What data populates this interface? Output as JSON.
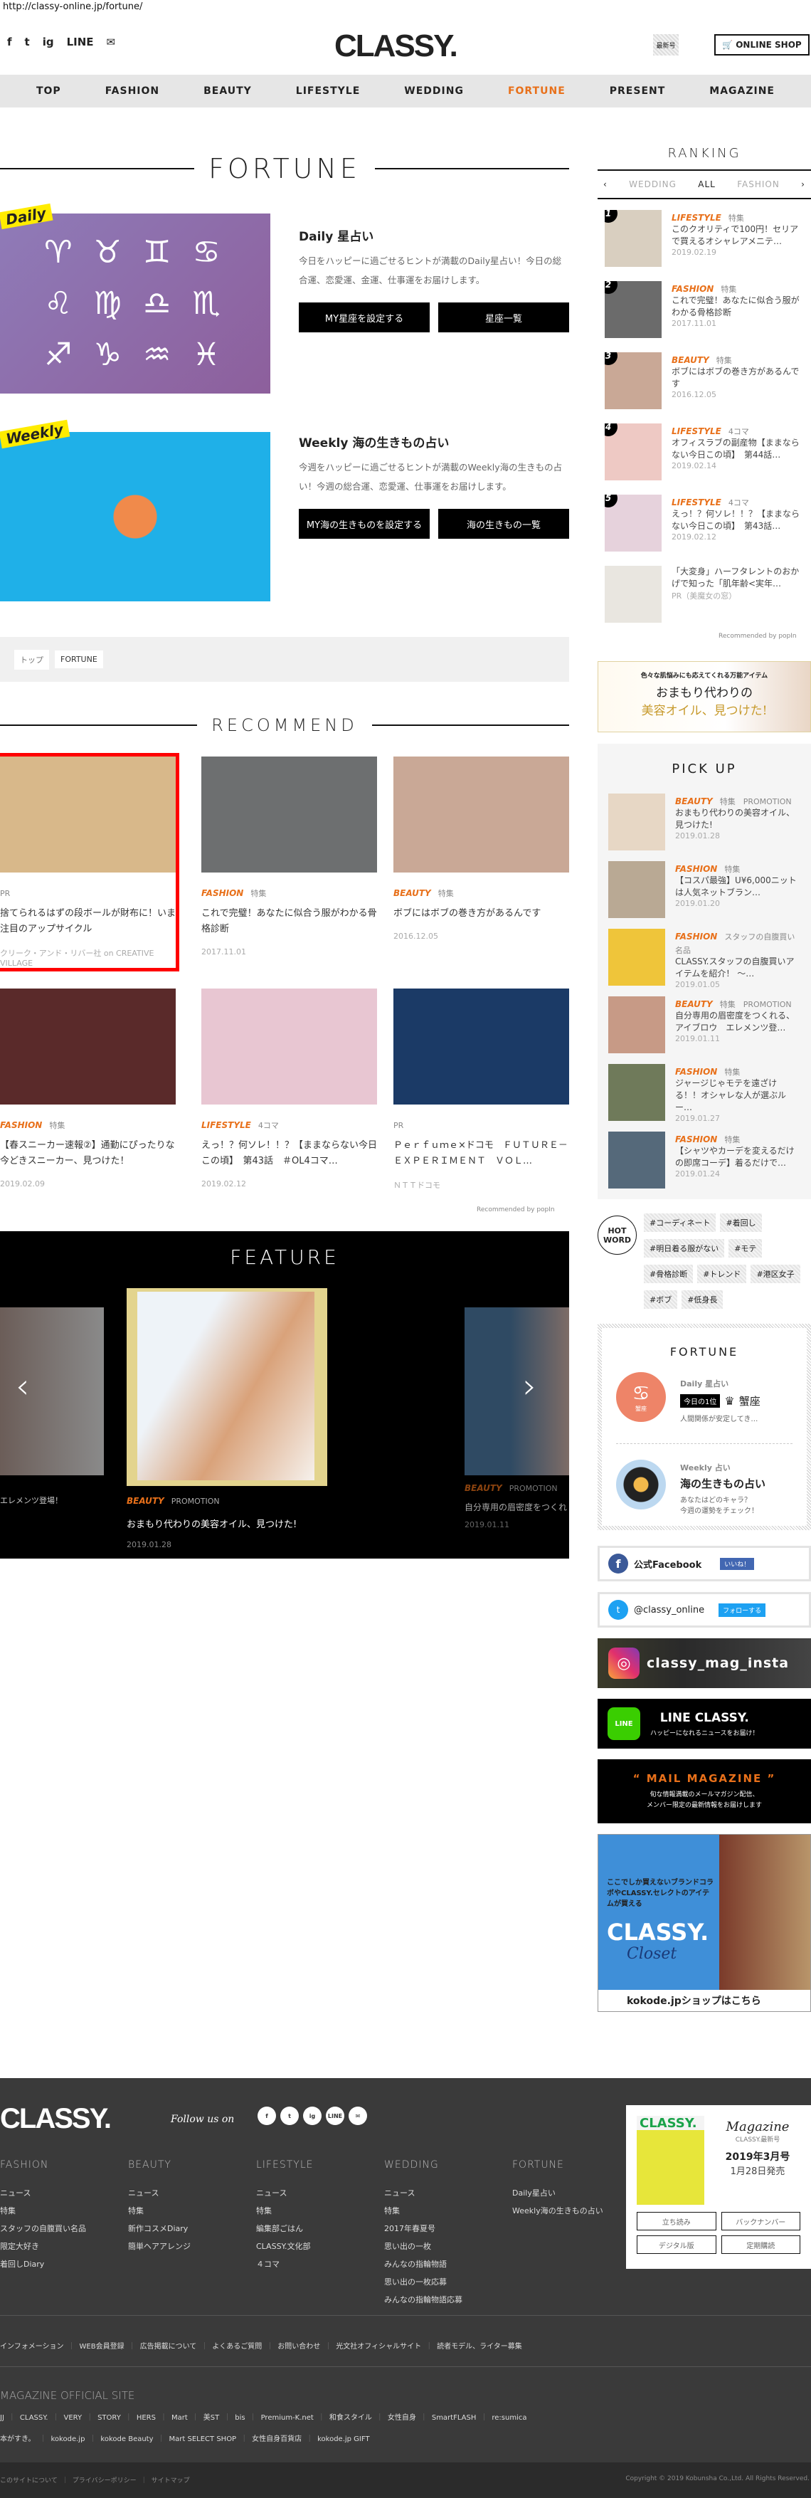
{
  "url": "http://classy-online.jp/fortune/",
  "header": {
    "logo": "CLASSY.",
    "social": [
      "f",
      "t",
      "ig",
      "LINE",
      "✉"
    ],
    "latest_label": "最新号",
    "shop_label": "ONLINE SHOP"
  },
  "nav": [
    {
      "label": "TOP"
    },
    {
      "label": "FASHION"
    },
    {
      "label": "BEAUTY"
    },
    {
      "label": "LIFESTYLE"
    },
    {
      "label": "WEDDING"
    },
    {
      "label": "FORTUNE",
      "active": true
    },
    {
      "label": "PRESENT"
    },
    {
      "label": "MAGAZINE"
    }
  ],
  "fortune": {
    "title": "FORTUNE",
    "daily": {
      "badge": "Daily",
      "heading": "Daily 星占い",
      "desc": "今日をハッピーに過ごせるヒントが満載のDaily星占い！今日の総合運、恋愛運、金運、仕事運をお届けします。",
      "btn1": "MY星座を設定する",
      "btn2": "星座一覧",
      "zodiac": "♈ ♉ ♊ ♋ ♌ ♍ ♎ ♏ ♐ ♑ ♒ ♓"
    },
    "weekly": {
      "badge": "Weekly",
      "heading": "Weekly 海の生きもの占い",
      "desc": "今週をハッピーに過ごせるヒントが満載のWeekly海の生きもの占い！今週の総合運、恋愛運、仕事運をお届けします。",
      "btn1": "MY海の生きものを設定する",
      "btn2": "海の生きもの一覧"
    }
  },
  "breadcrumb": [
    "トップ",
    "FORTUNE"
  ],
  "recommend": {
    "title": "RECOMMEND",
    "popin": "Recommended by popIn",
    "items": [
      {
        "tag": "",
        "sub": "PR",
        "title": "捨てられるはずの段ボールが財布に！いま注目のアップサイクル",
        "date": "クリーク・アンド・リバー社 on CREATIVE VILLAGE",
        "color": "#d8b88a"
      },
      {
        "tag": "FASHION",
        "sub": "特集",
        "title": "これで完璧！あなたに似合う服がわかる骨格診断",
        "date": "2017.11.01",
        "color": "#6d6f70"
      },
      {
        "tag": "BEAUTY",
        "sub": "特集",
        "title": "ボブにはボブの巻き方があるんです",
        "date": "2016.12.05",
        "color": "#c9a896"
      },
      {
        "tag": "FASHION",
        "sub": "特集",
        "title": "【春スニーカー速報②】通勤にぴったりな今どきスニーカー、見つけた！",
        "date": "2019.02.09",
        "color": "#5a2a2a"
      },
      {
        "tag": "LIFESTYLE",
        "sub": "4コマ",
        "title": "えっ！？何ソレ！！？【ままならない今日この頃】　第43話　＃OL4コマ…",
        "date": "2019.02.12",
        "color": "#e8c6d2"
      },
      {
        "tag": "",
        "sub": "PR",
        "title": "Ｐｅｒｆｕｍｅ×ドコモ　ＦＵＴＵＲＥ－ＥＸＰＥＲＩＭＥＮＴ　ＶＯＬ…",
        "date": "ＮＴＴドコモ",
        "color": "#1b3a66"
      }
    ]
  },
  "feature": {
    "title": "FEATURE",
    "left_caption": "エレメンツ登場！",
    "main": {
      "tag": "BEAUTY",
      "sub": "PROMOTION",
      "title": "おまもり代わりの美容オイル、見つけた!",
      "date": "2019.01.28"
    },
    "right": {
      "tag": "BEAUTY",
      "sub": "PROMOTION",
      "title": "自分専用の眉密度をつくれ",
      "date": "2019.01.11"
    }
  },
  "ranking": {
    "title": "RANKING",
    "tabs": [
      "WEDDING",
      "ALL",
      "FASHION"
    ],
    "popin": "Recommended by popIn",
    "items": [
      {
        "num": "1",
        "tag": "LIFESTYLE",
        "sub": "特集",
        "title": "このクオリティで100円！セリアで買えるオシャレアメニテ…",
        "date": "2019.02.19",
        "color": "#d9cfc0"
      },
      {
        "num": "2",
        "tag": "FASHION",
        "sub": "特集",
        "title": "これで完璧！あなたに似合う服がわかる骨格診断",
        "date": "2017.11.01",
        "color": "#6b6b6b"
      },
      {
        "num": "3",
        "tag": "BEAUTY",
        "sub": "特集",
        "title": "ボブにはボブの巻き方があるんです",
        "date": "2016.12.05",
        "color": "#c9a896"
      },
      {
        "num": "4",
        "tag": "LIFESTYLE",
        "sub": "4コマ",
        "title": "オフィスラブの副産物【ままならない今日この頃】　第44話…",
        "date": "2019.02.14",
        "color": "#eec9c4"
      },
      {
        "num": "5",
        "tag": "LIFESTYLE",
        "sub": "4コマ",
        "title": "えっ！？何ソレ！！？【ままならない今日この頃】　第43話…",
        "date": "2019.02.12",
        "color": "#e6d2dc"
      },
      {
        "num": "",
        "tag": "",
        "sub": "",
        "title": "「大変身」ハーフタレントのおかげで知った「肌年齢<実年…",
        "date": "PR（美魔女の窓）",
        "color": "#e9e6e0"
      }
    ]
  },
  "banner": {
    "line1": "色々な肌悩みにも応えてくれる万能アイテム",
    "line2": "おまもり代わりの",
    "line3": "美容オイル、見つけた!"
  },
  "pickup": {
    "title": "PICK UP",
    "items": [
      {
        "tag": "BEAUTY",
        "sub": "特集　PROMOTION",
        "title": "おまもり代わりの美容オイル、見つけた!",
        "date": "2019.01.28",
        "color": "#e7d7c5"
      },
      {
        "tag": "FASHION",
        "sub": "特集",
        "title": "【コスパ最強】U¥6,000ニットは人気ネットブラン…",
        "date": "2019.01.20",
        "color": "#b9a994"
      },
      {
        "tag": "FASHION",
        "sub": "スタッフの自腹買い名品",
        "title": "CLASSY.スタッフの自腹買いアイテムを紹介！ 〜…",
        "date": "2019.01.05",
        "color": "#efc53a"
      },
      {
        "tag": "BEAUTY",
        "sub": "特集　PROMOTION",
        "title": "自分専用の眉密度をつくれる、アイブロウ　エレメンツ登…",
        "date": "2019.01.11",
        "color": "#c79a86"
      },
      {
        "tag": "FASHION",
        "sub": "特集",
        "title": "ジャージじゃモテを遠ざける！！オシャレな人が選ぶルー…",
        "date": "2019.01.27",
        "color": "#6f7a5a"
      },
      {
        "tag": "FASHION",
        "sub": "特集",
        "title": "【シャツやカーデを変えるだけの即席コーデ】着るだけで…",
        "date": "2019.01.24",
        "color": "#55697a"
      }
    ]
  },
  "hotword": {
    "label1": "HOT",
    "label2": "WORD",
    "tags": [
      "#コーディネート",
      "#着回し",
      "#明日着る服がない",
      "#モテ",
      "#骨格診断",
      "#トレンド",
      "#港区女子",
      "#ボブ",
      "#低身長"
    ]
  },
  "side_fortune": {
    "title": "FORTUNE",
    "daily_label": "Daily 星占い",
    "rank_badge": "今日の1位",
    "sign": "蟹座",
    "sign_icon": "♋",
    "daily_text": "人間関係が安定してき…",
    "weekly_label": "Weekly 占い",
    "weekly_title": "海の生きもの占い",
    "weekly_text1": "あなたはどのキャラ？",
    "weekly_text2": "今週の運勢をチェック！"
  },
  "sns": {
    "facebook": "公式Facebook",
    "like": "いいね！",
    "twitter": "@classy_online",
    "follow": "フォローする",
    "instagram": "classy_mag_insta",
    "line_title": "LINE CLASSY.",
    "line_sub": "ハッピーになれるニュースをお届け！",
    "line_icon": "LINE",
    "mail_title": "“ MAIL MAGAZINE ”",
    "mail_sub1": "旬な情報満載のメールマガジン配信、",
    "mail_sub2": "メンバー限定の最新情報をお届けします"
  },
  "kokode": {
    "text": "ここでしか買えないブランドコラボやCLASSY.セレクトのアイテムが買える",
    "logo": "CLASSY.",
    "sub": "Closet",
    "cta": "kokode.jpショップはこちら"
  },
  "footer": {
    "logo": "CLASSY.",
    "follow": "Follow us on",
    "social": [
      "f",
      "t",
      "ig",
      "LINE",
      "✉"
    ],
    "columns": [
      {
        "title": "FASHION",
        "links": [
          "ニュース",
          "特集",
          "スタッフの自腹買い名品",
          "限定大好き",
          "着回しDiary"
        ]
      },
      {
        "title": "BEAUTY",
        "links": [
          "ニュース",
          "特集",
          "新作コスメDiary",
          "簡単ヘアアレンジ"
        ]
      },
      {
        "title": "LIFESTYLE",
        "links": [
          "ニュース",
          "特集",
          "編集部ごはん",
          "CLASSY.文化部",
          "４コマ"
        ]
      },
      {
        "title": "WEDDING",
        "links": [
          "ニュース",
          "特集",
          "2017年春夏号",
          "思い出の一枚",
          "みんなの指輪物語",
          "思い出の一枚応募",
          "みんなの指輪物語応募"
        ]
      },
      {
        "title": "FORTUNE",
        "links": [
          "Daily星占い",
          "Weekly海の生きもの占い"
        ]
      }
    ],
    "magazine": {
      "script": "Magazine",
      "label": "CLASSY.最新号",
      "issue": "2019年3月号",
      "release": "1月28日発売",
      "buttons": [
        "立ち読み",
        "バックナンバー",
        "デジタル版",
        "定期購読"
      ],
      "cover_logo": "CLASSY."
    },
    "info_links": [
      "インフォメーション",
      "WEB会員登録",
      "広告掲載について",
      "よくあるご質問",
      "お問い合わせ",
      "光文社オフィシャルサイト",
      "読者モデル、ライター募集"
    ],
    "official_title": "MAGAZINE OFFICIAL SITE",
    "sites1": [
      "JJ",
      "CLASSY.",
      "VERY",
      "STORY",
      "HERS",
      "Mart",
      "美ST",
      "bis",
      "Premium-K.net",
      "和食スタイル",
      "女性自身",
      "SmartFLASH",
      "re:sumica"
    ],
    "sites2": [
      "本がすき。",
      "kokode.jp",
      "kokode Beauty",
      "Mart SELECT SHOP",
      "女性自身百貨店",
      "kokode.jp GIFT"
    ],
    "bottom_links": [
      "このサイトについて",
      "プライバシーポリシー",
      "サイトマップ"
    ],
    "copyright": "Copyright © 2019 Kobunsha Co.,Ltd. All Rights Reserved."
  }
}
